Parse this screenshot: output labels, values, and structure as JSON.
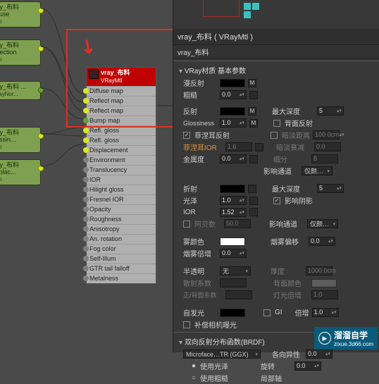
{
  "left_nodes": {
    "n1": {
      "label": "vray_布料 diffuse",
      "sub": "map"
    },
    "n2": {
      "label": "vray_布料 reflection",
      "sub": "map"
    },
    "n3": {
      "label": "vray_布料 ...",
      "sub": "VRayNor..."
    },
    "n4": {
      "label": "vray_布料 glossin...",
      "sub": "map"
    },
    "n5": {
      "label": "vray_布料 displac...",
      "sub": "map"
    }
  },
  "material_node": {
    "title": "vray_布料",
    "type": "VRayMtl",
    "rows": [
      "Diffuse map",
      "Reflect map",
      "Reflect map",
      "Bump map",
      "Refl. gloss",
      "Refl. gloss",
      "Displacement",
      "Environment",
      "Translucency",
      "IOR",
      "Hilight gloss",
      "Fresnel IOR",
      "Opacity",
      "Roughness",
      "Anisotropy",
      "An. rotation",
      "Fog color",
      "Self-Illum",
      "GTR tail falloff",
      "Metalness"
    ]
  },
  "panel": {
    "title": "vray_布料   ( VRayMtl )",
    "sub": "vray_布料",
    "sec_basic": "VRay材质  基本参数",
    "diffuse": {
      "lbl": "漫反射",
      "m": "M"
    },
    "rough": {
      "lbl": "粗糙",
      "val": "0.0"
    },
    "reflect": {
      "lbl": "反射",
      "m": "M",
      "maxdepth": "最大深度",
      "maxdepth_v": "5"
    },
    "gloss": {
      "lbl": "Glossiness",
      "val": "1.0",
      "m": "M",
      "backref": "背面反射"
    },
    "fresnel": {
      "lbl": "菲涅耳反射",
      "dim": "暗淡距离",
      "dim_v": "100.0cm"
    },
    "fior": {
      "lbl": "菲涅耳IOR",
      "val": "1.6",
      "dim": "暗淡衰减",
      "dim_v": "0.0"
    },
    "metal": {
      "lbl": "金属度",
      "val": "0.0",
      "sub": "细分",
      "sub_v": "8"
    },
    "chan": {
      "lbl": "影响通道",
      "val": "仅颜…"
    },
    "refract": {
      "lbl": "折射",
      "maxdepth": "最大深度",
      "maxdepth_v": "5"
    },
    "gloss2": {
      "lbl": "光泽",
      "val": "1.0",
      "shadow": "影响阴影"
    },
    "ior": {
      "lbl": "IOR",
      "val": "1.52"
    },
    "abbe": {
      "lbl": "阿贝数",
      "val": "50.0",
      "chan": "影响通道",
      "chan_v": "仅颜…"
    },
    "fog": {
      "lbl": "雾颜色",
      "bias": "烟雾偏移",
      "bias_v": "0.0"
    },
    "fogmul": {
      "lbl": "烟雾倍增",
      "val": "0.0"
    },
    "trans": {
      "lbl": "半透明",
      "val": "无",
      "thick": "厚度",
      "thick_v": "1000.0cm"
    },
    "scatter": {
      "lbl": "散射系数",
      "val": "",
      "back": "背面颜色"
    },
    "fb": {
      "lbl": "正/背面系数",
      "val": "",
      "light": "灯光倍增",
      "light_v": "1.0"
    },
    "self": {
      "lbl": "自发光",
      "gi": "GI",
      "mul": "倍增",
      "mul_v": "1.0"
    },
    "comp": {
      "lbl": "补偿相机曝光"
    },
    "brdf": {
      "hdr": "双向反射分布函数(BRDF)",
      "type": "Microface…TR  (GGX)",
      "aniso": "各向异性",
      "aniso_v": "0.0",
      "rot": "旋转",
      "rot_v": "0.0",
      "axis": "局部轴",
      "softtail": "使用光泽",
      "soft": "使用粗糙"
    },
    "watermark": {
      "brand": "溜溜自学",
      "url": "zixue.3d66.com"
    }
  }
}
